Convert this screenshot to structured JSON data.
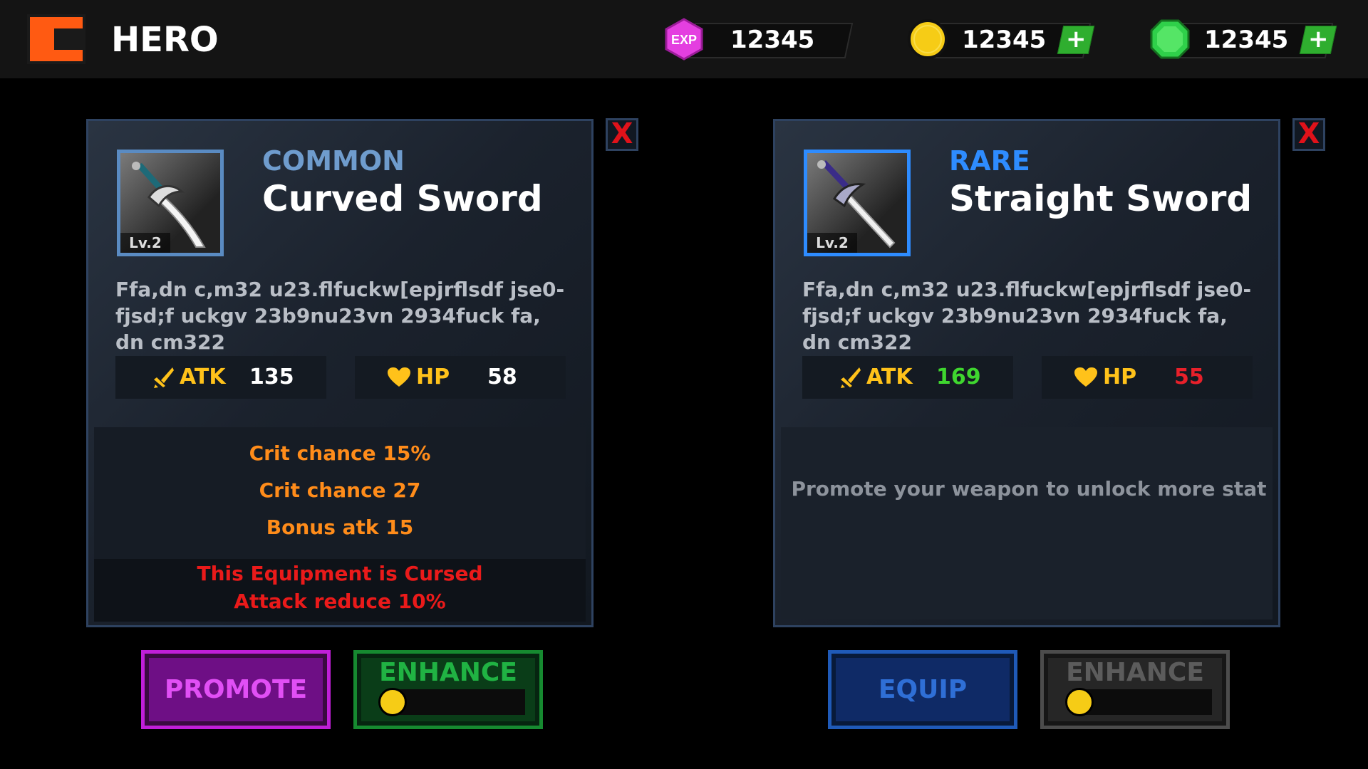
{
  "header": {
    "title": "HERO",
    "back_icon": "back-arrow-icon",
    "resources": [
      {
        "icon": "exp-hexagon-icon",
        "icon_label": "EXP",
        "value": "12345",
        "color": "#e43fe0"
      },
      {
        "icon": "gold-coin-icon",
        "value": "12345",
        "plus": "+",
        "color": "#f6cc16"
      },
      {
        "icon": "green-gem-icon",
        "value": "12345",
        "plus": "+",
        "color": "#2fd04a"
      }
    ]
  },
  "cards": [
    {
      "rarity": "COMMON",
      "rarity_color": "#6f9ccd",
      "name": "Curved Sword",
      "level": "Lv.2",
      "icon": "curved-sword-icon",
      "close": "X",
      "description": "Ffa,dn c,m32 u23.flfuckw[epjrflsdf jse0-fjsd;f uckgv 23b9nu23vn 2934fuck fa, dn cm322",
      "stats": {
        "atk_label": "ATK",
        "atk_value": "135",
        "atk_color": "#ffffff",
        "hp_label": "HP",
        "hp_value": "58",
        "hp_color": "#ffffff"
      },
      "bonuses": [
        "Crit chance 15%",
        "Crit chance  27",
        "Bonus atk 15"
      ],
      "curse": [
        "This Equipment is Cursed",
        "Attack reduce 10%"
      ]
    },
    {
      "rarity": "RARE",
      "rarity_color": "#2e8cff",
      "name": "Straight Sword",
      "level": "Lv.2",
      "icon": "straight-sword-icon",
      "close": "X",
      "description": "Ffa,dn c,m32 u23.flfuckw[epjrflsdf jse0-fjsd;f uckgv 23b9nu23vn 2934fuck fa, dn cm322",
      "stats": {
        "atk_label": "ATK",
        "atk_value": "169",
        "atk_color": "#3fd62f",
        "hp_label": "HP",
        "hp_value": "55",
        "hp_color": "#e8202a"
      },
      "locked_message": "Promote your weapon to unlock more stat"
    }
  ],
  "buttons": {
    "promote": "PROMOTE",
    "enhance_left": "ENHANCE",
    "equip": "EQUIP",
    "enhance_right": "ENHANCE"
  }
}
